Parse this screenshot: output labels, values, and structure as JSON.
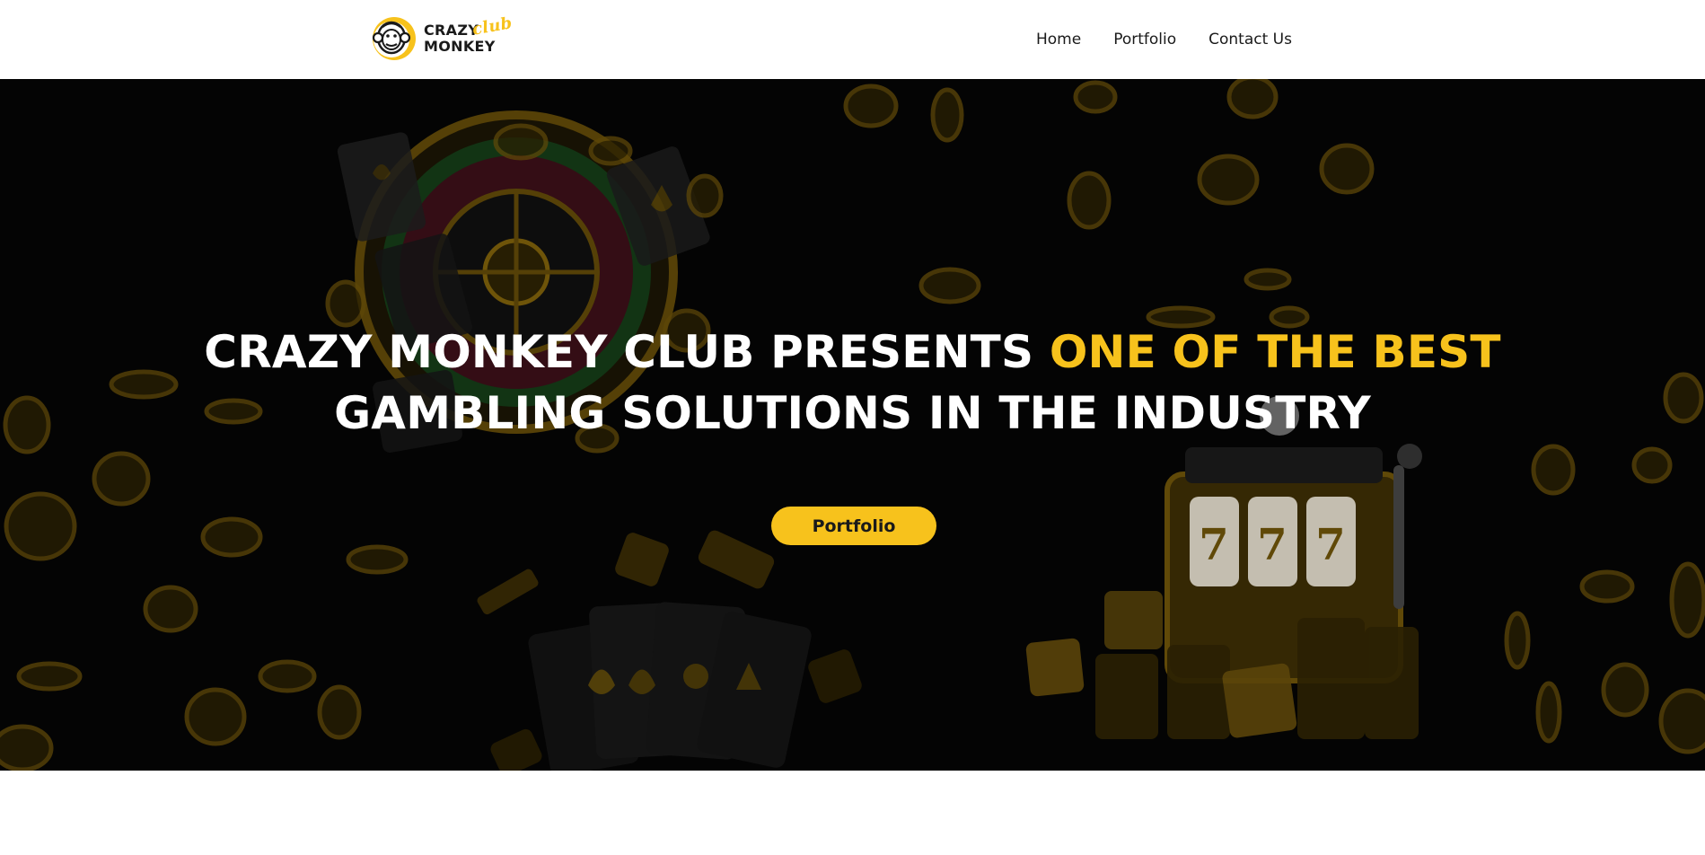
{
  "header": {
    "logo": {
      "line1": "CRAZY",
      "line2": "MONKEY",
      "script": "club"
    },
    "nav": [
      {
        "label": "Home"
      },
      {
        "label": "Portfolio"
      },
      {
        "label": "Contact Us"
      }
    ]
  },
  "hero": {
    "title_part1": "CRAZY MONKEY CLUB PRESENTS ",
    "title_accent": "ONE OF THE BEST",
    "title_part2": " GAMBLING SOLUTIONS IN THE INDUSTRY",
    "button_label": "Portfolio"
  },
  "colors": {
    "accent": "#f7c21c",
    "hero_bg": "#040404",
    "text_dark": "#1a1a1a"
  },
  "icons": [
    "monkey-logo-icon",
    "roulette-wheel-icon",
    "slot-machine-icon",
    "playing-cards-icon",
    "dice-icon",
    "casino-chip-icon"
  ]
}
